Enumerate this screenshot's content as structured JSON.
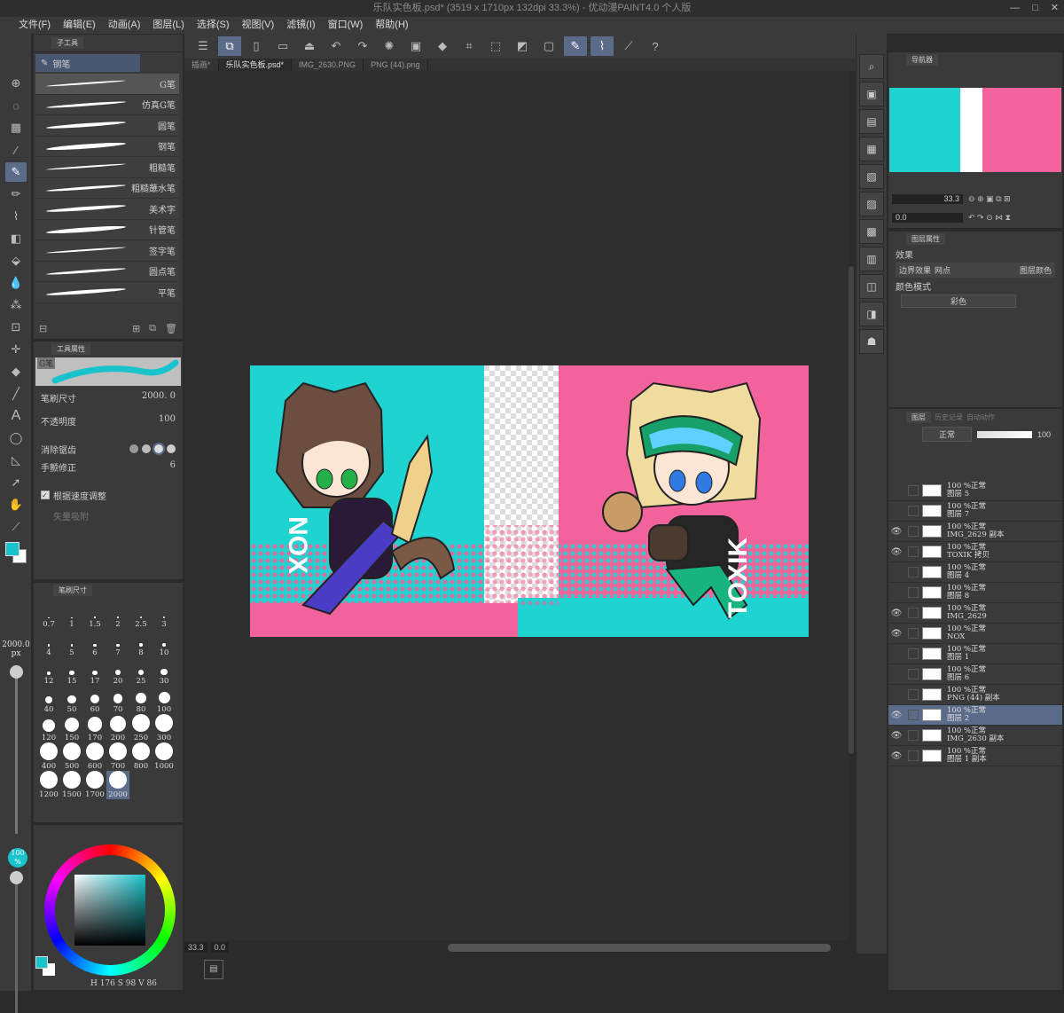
{
  "window": {
    "title": "乐队实色板.psd* (3519 x 1710px 132dpi 33.3%)  - 优动漫PAINT4.0 个人版",
    "min": "—",
    "max": "□",
    "close": "✕"
  },
  "menu": [
    "文件(F)",
    "编辑(E)",
    "动画(A)",
    "图层(L)",
    "选择(S)",
    "视图(V)",
    "滤镜(I)",
    "窗口(W)",
    "帮助(H)"
  ],
  "subtool": {
    "tab_label": "子工具",
    "group_label": "钢笔",
    "brushes": [
      "G笔",
      "仿真G笔",
      "圆笔",
      "钢笔",
      "粗糙笔",
      "粗糙蘸水笔",
      "美术字",
      "针管笔",
      "签字笔",
      "圆点笔",
      "平笔"
    ]
  },
  "toolprop": {
    "tab_label": "工具属性",
    "preview_label": "G笔",
    "brush_size_label": "笔刷尺寸",
    "brush_size_value": "2000. 0",
    "opacity_label": "不透明度",
    "opacity_value": "100",
    "antialias_label": "消除锯齿",
    "stabilize_label": "手颤修正",
    "stabilize_value": "6",
    "speed_label": "根据速度调整",
    "vector_label": "矢量吸附"
  },
  "brushsize": {
    "tab_label": "笔刷尺寸",
    "sizes": [
      "0.7",
      "1",
      "1.5",
      "2",
      "2.5",
      "3",
      "4",
      "5",
      "6",
      "7",
      "8",
      "10",
      "12",
      "15",
      "17",
      "20",
      "25",
      "30",
      "40",
      "50",
      "60",
      "70",
      "80",
      "100",
      "120",
      "150",
      "170",
      "200",
      "250",
      "300",
      "400",
      "500",
      "600",
      "700",
      "800",
      "1000",
      "1200",
      "1500",
      "1700",
      "2000"
    ],
    "selected": "2000"
  },
  "left_slider": {
    "size": "2000.0",
    "unit": "px",
    "opacity": "100",
    "opacity_unit": "%"
  },
  "color": {
    "main": "#19c3cc",
    "sub": "#ffffff",
    "footer": "H 176 S 98 V 86"
  },
  "tabs": [
    "插画*",
    "乐队实色板.psd*",
    "IMG_2630.PNG",
    "PNG (44).png"
  ],
  "active_tab": 1,
  "statusbar": {
    "zoom": "33.3",
    "angle": "0.0"
  },
  "navigator": {
    "tab_label": "导航器",
    "zoom": "33.3",
    "angle": "0.0"
  },
  "layerprop": {
    "tab_label": "图层属性",
    "effect_label": "效果",
    "border_label": "边界效果",
    "tone_label": "网点",
    "layercolor_label": "图层颜色",
    "colormode_label": "颜色模式",
    "colormode_value": "彩色"
  },
  "layerpanel": {
    "tab_label": "图层",
    "tab2": "历史记录",
    "tab3": "自动动作",
    "blend": "正常",
    "opacity": "100",
    "layers": [
      {
        "mode": "100 %正常",
        "name": "图层 5",
        "visible": false
      },
      {
        "mode": "100 %正常",
        "name": "图层 7",
        "visible": false
      },
      {
        "mode": "100 %正常",
        "name": "IMG_2629 副本",
        "visible": true
      },
      {
        "mode": "100 %正常",
        "name": "TOXIK 拷贝",
        "visible": true
      },
      {
        "mode": "100 %正常",
        "name": "图层 4",
        "visible": false
      },
      {
        "mode": "100 %正常",
        "name": "图层 8",
        "visible": false
      },
      {
        "mode": "100 %正常",
        "name": "IMG_2629",
        "visible": true
      },
      {
        "mode": "100 %正常",
        "name": "NOX",
        "visible": true
      },
      {
        "mode": "100 %正常",
        "name": "图层 1",
        "visible": false
      },
      {
        "mode": "100 %正常",
        "name": "图层 6",
        "visible": false
      },
      {
        "mode": "100 %正常",
        "name": "PNG (44) 副本",
        "visible": false
      },
      {
        "mode": "100 %正常",
        "name": "图层 2",
        "visible": true,
        "selected": true
      },
      {
        "mode": "100 %正常",
        "name": "IMG_2630 副本",
        "visible": true
      },
      {
        "mode": "100 %正常",
        "name": "图层 1 副本",
        "visible": true
      }
    ]
  },
  "artwork": {
    "left_text": "NOX",
    "right_text": "TOXIK",
    "cyan": "#1fd3d0",
    "pink": "#f2639b"
  }
}
